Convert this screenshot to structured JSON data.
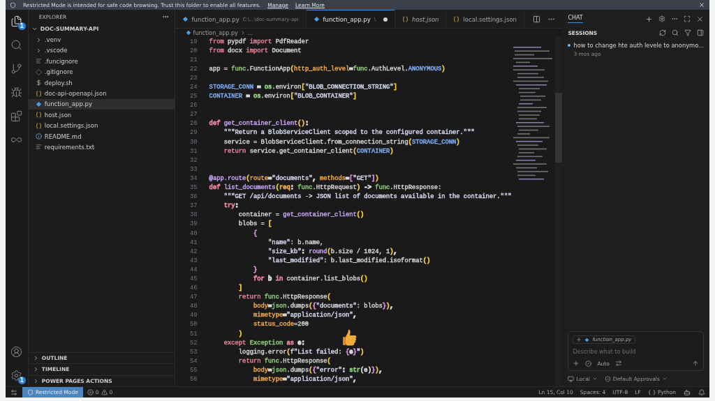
{
  "banner": {
    "text": "Restricted Mode is intended for safe code browsing. Trust this folder to enable all features.",
    "links": [
      "Manage",
      "Learn More"
    ]
  },
  "activity_bar": {
    "top": [
      {
        "kind": "files",
        "badge": "1",
        "selected": true
      },
      {
        "kind": "search",
        "selected": false
      },
      {
        "kind": "source-control",
        "selected": false
      },
      {
        "kind": "run",
        "selected": false
      },
      {
        "kind": "extensions",
        "selected": false
      },
      {
        "kind": "swirl",
        "selected": false
      }
    ],
    "bottom": [
      {
        "kind": "account"
      },
      {
        "kind": "settings",
        "badge": "1"
      }
    ]
  },
  "explorer": {
    "title": "EXPLORER",
    "root": {
      "label": "DOC-SUMMARY-API",
      "expanded": true,
      "children": [
        {
          "label": ".venv",
          "kind": "folder",
          "expanded": false,
          "selected": false
        },
        {
          "label": ".vscode",
          "kind": "folder",
          "expanded": false,
          "selected": false
        },
        {
          "label": ".funcignore",
          "kind": "lines",
          "selected": false
        },
        {
          "label": ".gitignore",
          "kind": "diamond",
          "selected": false
        },
        {
          "label": "deploy.sh",
          "kind": "shell",
          "selected": false
        },
        {
          "label": "doc-api-openapi.json",
          "kind": "json",
          "selected": false
        },
        {
          "label": "function_app.py",
          "kind": "python",
          "selected": true
        },
        {
          "label": "host.json",
          "kind": "json",
          "selected": false
        },
        {
          "label": "local.settings.json",
          "kind": "json",
          "selected": false
        },
        {
          "label": "README.md",
          "kind": "info",
          "selected": false
        },
        {
          "label": "requirements.txt",
          "kind": "lines",
          "selected": false
        }
      ]
    },
    "sections": [
      {
        "label": "OUTLINE",
        "expanded": false
      },
      {
        "label": "TIMELINE",
        "expanded": false
      },
      {
        "label": "POWER PAGES ACTIONS",
        "expanded": false
      }
    ]
  },
  "tabs": [
    {
      "label": "function_app.py",
      "description": "C:\\...\\doc-summary-api",
      "kind": "python",
      "selected": false,
      "modified": false,
      "preview": false
    },
    {
      "label": "function_app.py",
      "description": "\\",
      "kind": "python",
      "selected": true,
      "modified": true,
      "preview": false
    },
    {
      "label": "host.json",
      "kind": "json",
      "selected": false,
      "modified": false,
      "preview": true
    },
    {
      "label": "local.settings.json",
      "kind": "json",
      "selected": false,
      "modified": false,
      "preview": false
    }
  ],
  "breadcrumb": [
    "function_app.py",
    "..."
  ],
  "code": [
    {
      "n": "19",
      "tokens": [
        {
          "t": "from",
          "color": "#e7839a"
        },
        {
          "t": " pypdf ",
          "color": "#d6d6d6"
        },
        {
          "t": "import",
          "color": "#e7839a"
        },
        {
          "t": " PdfReader",
          "color": "#d6d6d6"
        }
      ]
    },
    {
      "n": "20",
      "tokens": [
        {
          "t": "from",
          "color": "#e7839a"
        },
        {
          "t": " docx ",
          "color": "#d6d6d6"
        },
        {
          "t": "import",
          "color": "#e7839a"
        },
        {
          "t": " Document",
          "color": "#d6d6d6"
        }
      ]
    },
    {
      "n": "21"
    },
    {
      "n": "22",
      "tokens": [
        {
          "t": "app = ",
          "color": "#d6d6d6"
        },
        {
          "t": "func",
          "color": "#8fd17a"
        },
        {
          "t": ".FunctionApp",
          "color": "#d6d6d6"
        },
        {
          "t": "(",
          "color": "#f0c83c"
        },
        {
          "t": "http_auth_level",
          "color": "#f2a94b"
        },
        {
          "t": "=",
          "color": "#d6d6d6"
        },
        {
          "t": "func",
          "color": "#8fd17a"
        },
        {
          "t": ".AuthLevel.",
          "color": "#d6d6d6"
        },
        {
          "t": "ANONYMOUS",
          "color": "#7fb0f5"
        },
        {
          "t": ")",
          "color": "#f0c83c"
        }
      ]
    },
    {
      "n": "23"
    },
    {
      "n": "24",
      "tokens": [
        {
          "t": "STORAGE_CONN",
          "color": "#7fb0f5"
        },
        {
          "t": " = ",
          "color": "#d6d6d6"
        },
        {
          "t": "os",
          "color": "#8fd17a"
        },
        {
          "t": ".environ",
          "color": "#d6d6d6"
        },
        {
          "t": "[",
          "color": "#f0c83c"
        },
        {
          "t": "\"BLOB_CONNECTION_STRING\"",
          "color": "#d9dcf2"
        },
        {
          "t": "]",
          "color": "#f0c83c"
        }
      ]
    },
    {
      "n": "25",
      "tokens": [
        {
          "t": "CONTAINER",
          "color": "#7fb0f5"
        },
        {
          "t": " = ",
          "color": "#d6d6d6"
        },
        {
          "t": "os",
          "color": "#8fd17a"
        },
        {
          "t": ".environ",
          "color": "#d6d6d6"
        },
        {
          "t": "[",
          "color": "#f0c83c"
        },
        {
          "t": "\"BLOB_CONTAINER\"",
          "color": "#d9dcf2"
        },
        {
          "t": "]",
          "color": "#f0c83c"
        }
      ]
    },
    {
      "n": "26"
    },
    {
      "n": "27"
    },
    {
      "n": "28",
      "tokens": [
        {
          "t": "def",
          "color": "#e7839a"
        },
        {
          "t": " get_container_client",
          "color": "#c9a6f5"
        },
        {
          "t": "()",
          "color": "#f0c83c"
        },
        {
          "t": ":",
          "color": "#d6d6d6"
        }
      ]
    },
    {
      "n": "29",
      "tokens": [
        {
          "t": "    \"\"\"Return a BlobServiceClient scoped to the configured container.\"\"\"",
          "color": "#d9dcf2"
        }
      ]
    },
    {
      "n": "30",
      "tokens": [
        {
          "t": "    service = BlobServiceClient.from_connection_string",
          "color": "#d6d6d6"
        },
        {
          "t": "(",
          "color": "#f0c83c"
        },
        {
          "t": "STORAGE_CONN",
          "color": "#7fb0f5"
        },
        {
          "t": ")",
          "color": "#f0c83c"
        }
      ]
    },
    {
      "n": "31",
      "tokens": [
        {
          "t": "    return",
          "color": "#e7839a"
        },
        {
          "t": " service.get_container_client",
          "color": "#d6d6d6"
        },
        {
          "t": "(",
          "color": "#f0c83c"
        },
        {
          "t": "CONTAINER",
          "color": "#7fb0f5"
        },
        {
          "t": ")",
          "color": "#f0c83c"
        }
      ]
    },
    {
      "n": "32"
    },
    {
      "n": "33"
    },
    {
      "n": "34",
      "tokens": [
        {
          "t": "@app.route",
          "color": "#c9a6f5"
        },
        {
          "t": "(",
          "color": "#f0c83c"
        },
        {
          "t": "route",
          "color": "#f2a94b"
        },
        {
          "t": "=",
          "color": "#d6d6d6"
        },
        {
          "t": "\"documents\"",
          "color": "#d9dcf2"
        },
        {
          "t": ", ",
          "color": "#d6d6d6"
        },
        {
          "t": "methods",
          "color": "#f2a94b"
        },
        {
          "t": "=",
          "color": "#d6d6d6"
        },
        {
          "t": "[",
          "color": "#d28bd6"
        },
        {
          "t": "\"GET\"",
          "color": "#d9dcf2"
        },
        {
          "t": "]",
          "color": "#d28bd6"
        },
        {
          "t": ")",
          "color": "#f0c83c"
        }
      ]
    },
    {
      "n": "35",
      "tokens": [
        {
          "t": "def",
          "color": "#e7839a"
        },
        {
          "t": " list_documents",
          "color": "#c9a6f5"
        },
        {
          "t": "(",
          "color": "#f0c83c"
        },
        {
          "t": "req",
          "color": "#f2a94b"
        },
        {
          "t": ": ",
          "color": "#d6d6d6"
        },
        {
          "t": "func",
          "color": "#8fd17a"
        },
        {
          "t": ".HttpRequest",
          "color": "#d6d6d6"
        },
        {
          "t": ")",
          "color": "#f0c83c"
        },
        {
          "t": " -> ",
          "color": "#d6d6d6"
        },
        {
          "t": "func",
          "color": "#8fd17a"
        },
        {
          "t": ".HttpResponse:",
          "color": "#d6d6d6"
        }
      ]
    },
    {
      "n": "36",
      "tokens": [
        {
          "t": "    \"\"\"GET /api/documents -> JSON list of documents available in the container.\"\"\"",
          "color": "#d9dcf2"
        }
      ]
    },
    {
      "n": "37",
      "tokens": [
        {
          "t": "    try",
          "color": "#e7839a"
        },
        {
          "t": ":",
          "color": "#d6d6d6"
        }
      ]
    },
    {
      "n": "38",
      "tokens": [
        {
          "t": "        container = ",
          "color": "#d6d6d6"
        },
        {
          "t": "get_container_client",
          "color": "#c9a6f5"
        },
        {
          "t": "()",
          "color": "#f0c83c"
        }
      ]
    },
    {
      "n": "39",
      "tokens": [
        {
          "t": "        blobs = ",
          "color": "#d6d6d6"
        },
        {
          "t": "[",
          "color": "#f0c83c"
        }
      ]
    },
    {
      "n": "40",
      "tokens": [
        {
          "t": "            {",
          "color": "#d28bd6"
        }
      ]
    },
    {
      "n": "41",
      "tokens": [
        {
          "t": "                \"name\"",
          "color": "#d9dcf2"
        },
        {
          "t": ": b.name,",
          "color": "#d6d6d6"
        }
      ]
    },
    {
      "n": "42",
      "tokens": [
        {
          "t": "                \"size_kb\"",
          "color": "#d9dcf2"
        },
        {
          "t": ": ",
          "color": "#d6d6d6"
        },
        {
          "t": "round",
          "color": "#c9a6f5"
        },
        {
          "t": "(",
          "color": "#f0c83c"
        },
        {
          "t": "b.size / 1024, 1",
          "color": "#d6d6d6"
        },
        {
          "t": ")",
          "color": "#f0c83c"
        },
        {
          "t": ",",
          "color": "#d6d6d6"
        }
      ]
    },
    {
      "n": "43",
      "tokens": [
        {
          "t": "                \"last_modified\"",
          "color": "#d9dcf2"
        },
        {
          "t": ": b.last_modified.isoformat",
          "color": "#d6d6d6"
        },
        {
          "t": "()",
          "color": "#f0c83c"
        }
      ]
    },
    {
      "n": "44",
      "tokens": [
        {
          "t": "            }",
          "color": "#d28bd6"
        }
      ]
    },
    {
      "n": "45",
      "tokens": [
        {
          "t": "            for",
          "color": "#e7839a"
        },
        {
          "t": " b ",
          "color": "#d6d6d6"
        },
        {
          "t": "in",
          "color": "#e7839a"
        },
        {
          "t": " container.list_blobs",
          "color": "#d6d6d6"
        },
        {
          "t": "()",
          "color": "#f0c83c"
        }
      ]
    },
    {
      "n": "46",
      "tokens": [
        {
          "t": "        ]",
          "color": "#f0c83c"
        }
      ]
    },
    {
      "n": "47",
      "tokens": [
        {
          "t": "        return",
          "color": "#e7839a"
        },
        {
          "t": " func",
          "color": "#8fd17a"
        },
        {
          "t": ".HttpResponse",
          "color": "#d6d6d6"
        },
        {
          "t": "(",
          "color": "#f0c83c"
        }
      ]
    },
    {
      "n": "48",
      "tokens": [
        {
          "t": "            body",
          "color": "#f2a94b"
        },
        {
          "t": "=",
          "color": "#d6d6d6"
        },
        {
          "t": "json",
          "color": "#8fd17a"
        },
        {
          "t": ".dumps",
          "color": "#d6d6d6"
        },
        {
          "t": "(",
          "color": "#f0c83c"
        },
        {
          "t": "{",
          "color": "#d28bd6"
        },
        {
          "t": "\"documents\"",
          "color": "#d9dcf2"
        },
        {
          "t": ": blobs",
          "color": "#d6d6d6"
        },
        {
          "t": "}",
          "color": "#d28bd6"
        },
        {
          "t": ")",
          "color": "#f0c83c"
        },
        {
          "t": ",",
          "color": "#d6d6d6"
        }
      ]
    },
    {
      "n": "49",
      "tokens": [
        {
          "t": "            mimetype",
          "color": "#f2a94b"
        },
        {
          "t": "=",
          "color": "#d6d6d6"
        },
        {
          "t": "\"application/json\"",
          "color": "#d9dcf2"
        },
        {
          "t": ",",
          "color": "#d6d6d6"
        }
      ]
    },
    {
      "n": "50",
      "tokens": [
        {
          "t": "            status_code",
          "color": "#f2a94b"
        },
        {
          "t": "=200",
          "color": "#d6d6d6"
        }
      ]
    },
    {
      "n": "51",
      "tokens": [
        {
          "t": "        )",
          "color": "#f0c83c"
        }
      ]
    },
    {
      "n": "52",
      "tokens": [
        {
          "t": "    except",
          "color": "#e7839a"
        },
        {
          "t": " Exception ",
          "color": "#8fd17a"
        },
        {
          "t": "as",
          "color": "#e7839a"
        },
        {
          "t": " e:",
          "color": "#d6d6d6"
        }
      ]
    },
    {
      "n": "53",
      "tokens": [
        {
          "t": "        logging.error",
          "color": "#d6d6d6"
        },
        {
          "t": "(",
          "color": "#f0c83c"
        },
        {
          "t": "f\"List failed: ",
          "color": "#d9dcf2"
        },
        {
          "t": "{",
          "color": "#d28bd6"
        },
        {
          "t": "e",
          "color": "#d6d6d6"
        },
        {
          "t": "}",
          "color": "#d28bd6"
        },
        {
          "t": "\"",
          "color": "#d9dcf2"
        },
        {
          "t": ")",
          "color": "#f0c83c"
        }
      ]
    },
    {
      "n": "54",
      "tokens": [
        {
          "t": "        return",
          "color": "#e7839a"
        },
        {
          "t": " func",
          "color": "#8fd17a"
        },
        {
          "t": ".HttpResponse",
          "color": "#d6d6d6"
        },
        {
          "t": "(",
          "color": "#f0c83c"
        }
      ]
    },
    {
      "n": "55",
      "tokens": [
        {
          "t": "            body",
          "color": "#f2a94b"
        },
        {
          "t": "=",
          "color": "#d6d6d6"
        },
        {
          "t": "json",
          "color": "#8fd17a"
        },
        {
          "t": ".dumps",
          "color": "#d6d6d6"
        },
        {
          "t": "(",
          "color": "#f0c83c"
        },
        {
          "t": "{",
          "color": "#d28bd6"
        },
        {
          "t": "\"error\"",
          "color": "#d9dcf2"
        },
        {
          "t": ": ",
          "color": "#d6d6d6"
        },
        {
          "t": "str",
          "color": "#8fd17a"
        },
        {
          "t": "(e)",
          "color": "#d6d6d6"
        },
        {
          "t": "}",
          "color": "#d28bd6"
        },
        {
          "t": ")",
          "color": "#f0c83c"
        },
        {
          "t": ",",
          "color": "#d6d6d6"
        }
      ]
    },
    {
      "n": "56",
      "tokens": [
        {
          "t": "            mimetype",
          "color": "#f2a94b"
        },
        {
          "t": "=",
          "color": "#d6d6d6"
        },
        {
          "t": "\"application/json\"",
          "color": "#d9dcf2"
        },
        {
          "t": ",",
          "color": "#d6d6d6"
        }
      ]
    }
  ],
  "chat": {
    "title": "CHAT",
    "sessions_title": "SESSIONS",
    "sessions": [
      {
        "title": "how to change hte auth levele to anonymo...",
        "time": "3 mos ago"
      }
    ],
    "attachment": "function_app.py",
    "input": {
      "placeholder": "Describe what to build"
    },
    "mode": "Auto",
    "location": "Local",
    "approvals": "Default Approvals"
  },
  "status_bar": {
    "mode": "Restricted Mode",
    "errors": "0",
    "warnings": "0",
    "right": [
      "Ln 15, Col 10",
      "Spaces: 4",
      "UTF-8",
      "LF",
      "{ } Python"
    ]
  }
}
